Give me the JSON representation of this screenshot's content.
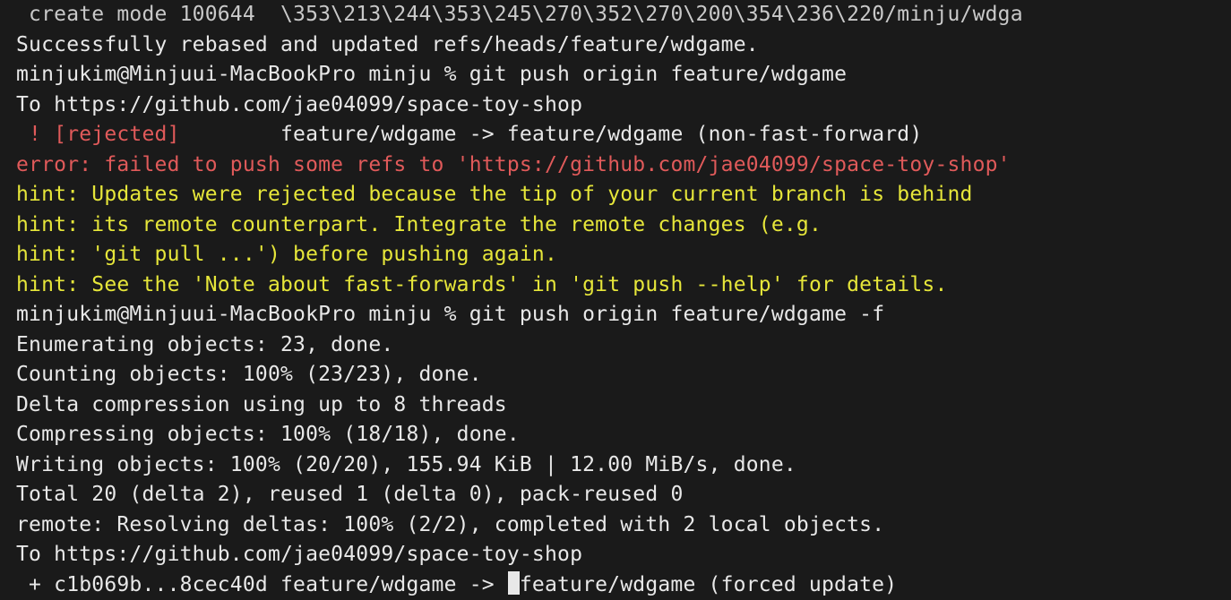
{
  "lines": [
    {
      "segments": [
        {
          "cls": "dim",
          "text": " create mode 100644  \\353\\213\\244\\353\\245\\270\\352\\270\\200\\354\\236\\220/minju/wdga"
        }
      ]
    },
    {
      "segments": [
        {
          "cls": "white",
          "text": "Successfully rebased and updated refs/heads/feature/wdgame."
        }
      ]
    },
    {
      "segments": [
        {
          "cls": "white",
          "text": "minjukim@Minjuui-MacBookPro minju % git push origin feature/wdgame"
        }
      ]
    },
    {
      "segments": [
        {
          "cls": "white",
          "text": "To https://github.com/jae04099/space-toy-shop"
        }
      ]
    },
    {
      "segments": [
        {
          "cls": "red",
          "text": " ! [rejected]        "
        },
        {
          "cls": "white",
          "text": "feature/wdgame -> feature/wdgame (non-fast-forward)"
        }
      ]
    },
    {
      "segments": [
        {
          "cls": "red",
          "text": "error: failed to push some refs to 'https://github.com/jae04099/space-toy-shop'"
        }
      ]
    },
    {
      "segments": [
        {
          "cls": "yellow",
          "text": "hint: Updates were rejected because the tip of your current branch is behind"
        }
      ]
    },
    {
      "segments": [
        {
          "cls": "yellow",
          "text": "hint: its remote counterpart. Integrate the remote changes (e.g."
        }
      ]
    },
    {
      "segments": [
        {
          "cls": "yellow",
          "text": "hint: 'git pull ...') before pushing again."
        }
      ]
    },
    {
      "segments": [
        {
          "cls": "yellow",
          "text": "hint: See the 'Note about fast-forwards' in 'git push --help' for details."
        }
      ]
    },
    {
      "segments": [
        {
          "cls": "white",
          "text": "minjukim@Minjuui-MacBookPro minju % git push origin feature/wdgame -f"
        }
      ]
    },
    {
      "segments": [
        {
          "cls": "white",
          "text": "Enumerating objects: 23, done."
        }
      ]
    },
    {
      "segments": [
        {
          "cls": "white",
          "text": "Counting objects: 100% (23/23), done."
        }
      ]
    },
    {
      "segments": [
        {
          "cls": "white",
          "text": "Delta compression using up to 8 threads"
        }
      ]
    },
    {
      "segments": [
        {
          "cls": "white",
          "text": "Compressing objects: 100% (18/18), done."
        }
      ]
    },
    {
      "segments": [
        {
          "cls": "white",
          "text": "Writing objects: 100% (20/20), 155.94 KiB | 12.00 MiB/s, done."
        }
      ]
    },
    {
      "segments": [
        {
          "cls": "white",
          "text": "Total 20 (delta 2), reused 1 (delta 0), pack-reused 0"
        }
      ]
    },
    {
      "segments": [
        {
          "cls": "white",
          "text": "remote: Resolving deltas: 100% (2/2), completed with 2 local objects."
        }
      ]
    },
    {
      "segments": [
        {
          "cls": "white",
          "text": "To https://github.com/jae04099/space-toy-shop"
        }
      ]
    },
    {
      "segments": [
        {
          "cls": "white",
          "text": " + c1b069b...8cec40d feature/wdgame -> "
        }
      ],
      "cursor_after": true,
      "tail": {
        "cls": "white",
        "text": "feature/wdgame (forced update)"
      }
    }
  ]
}
